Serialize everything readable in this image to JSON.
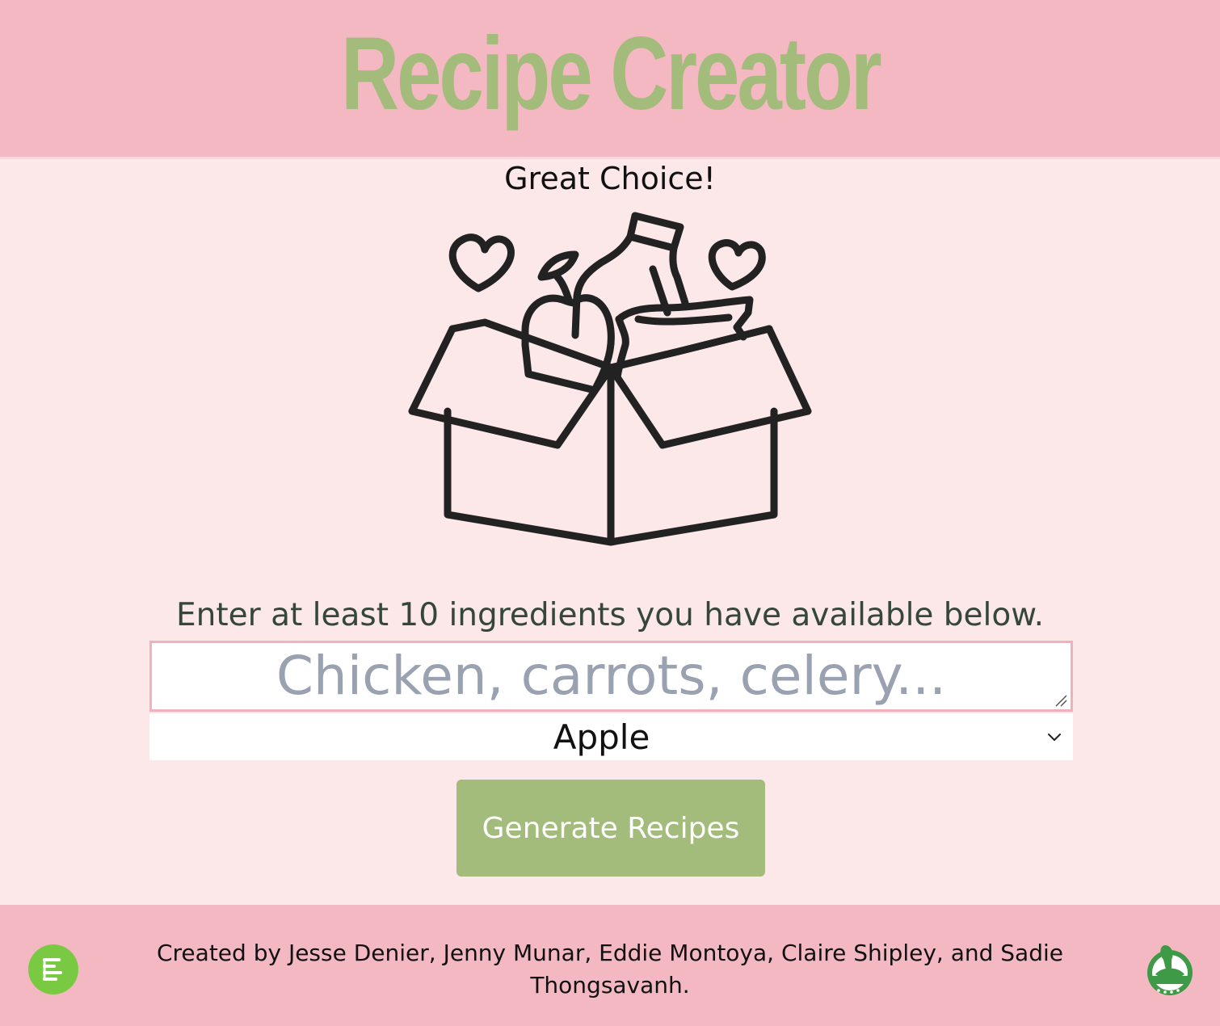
{
  "header": {
    "title": "Recipe Creator"
  },
  "main": {
    "greeting": "Great Choice!",
    "illustration_icon": "grocery-box-icon",
    "instructions": "Enter at least 10 ingredients you have available below.",
    "ingredients_input": {
      "value": "",
      "placeholder": "Chicken, carrots, celery..."
    },
    "ingredient_select": {
      "selected": "Apple"
    },
    "generate_button_label": "Generate Recipes"
  },
  "footer": {
    "credits": "Created by Jesse Denier, Jenny Munar, Eddie Montoya, Claire Shipley, and Sadie Thongsavanh.",
    "menu_icon": "menu-icon",
    "logo": "spoonacular-logo"
  },
  "colors": {
    "header_bg": "#f4b8c3",
    "page_bg": "#fce8e8",
    "accent_green": "#a4bc7b",
    "fab_green": "#7ac943",
    "input_border": "#f0b1bd"
  }
}
